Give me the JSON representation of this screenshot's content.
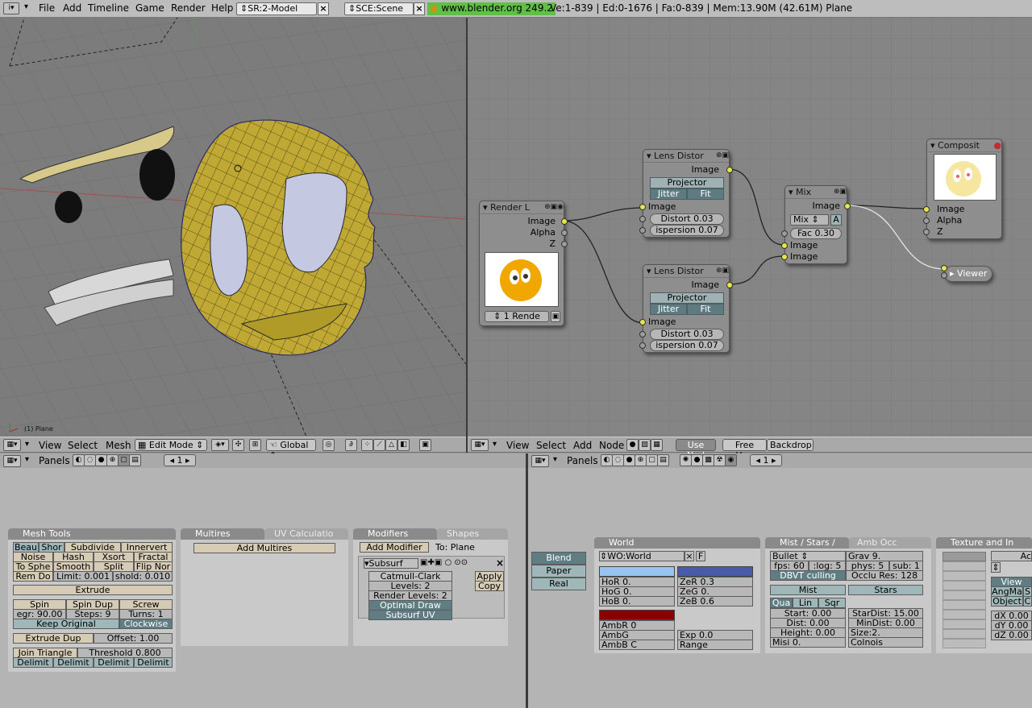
{
  "topbar": {
    "menus": [
      "File",
      "Add",
      "Timeline",
      "Game",
      "Render",
      "Help"
    ],
    "screen": "SR:2-Model",
    "scene": "SCE:Scene",
    "url": "www.blender.org 249.2",
    "stats": "Ve:1-839 | Ed:0-1676 | Fa:0-839 | Mem:13.90M (42.61M) Plane"
  },
  "viewport": {
    "object_label": "(1) Plane"
  },
  "view3d_header": {
    "menus": [
      "View",
      "Select",
      "Mesh"
    ],
    "mode": "Edit Mode",
    "orientation": "Global"
  },
  "node_header": {
    "menus": [
      "View",
      "Select",
      "Add",
      "Node"
    ],
    "use_nodes": "Use Nod",
    "free_unused": "Free Unu",
    "backdrop": "Backdrop"
  },
  "nodes": {
    "render_layers": {
      "title": "Render L",
      "out_image": "Image",
      "out_alpha": "Alpha",
      "out_z": "Z",
      "layer": "1 Rende"
    },
    "lens1": {
      "title": "Lens Distor",
      "out_image": "Image",
      "projector": "Projector",
      "jitter": "Jitter",
      "fit": "Fit",
      "in_image": "Image",
      "distort": "Distort 0.03",
      "dispersion": "ispersion 0.07"
    },
    "lens2": {
      "title": "Lens Distor",
      "out_image": "Image",
      "projector": "Projector",
      "jitter": "Jitter",
      "fit": "Fit",
      "in_image": "Image",
      "distort": "Distort 0.03",
      "dispersion": "ispersion 0.07"
    },
    "mix": {
      "title": "Mix",
      "out_image": "Image",
      "blend": "Mix",
      "alpha": "A",
      "fac": "Fac 0.30",
      "in1": "Image",
      "in2": "Image"
    },
    "composite": {
      "title": "Composit",
      "in_image": "Image",
      "in_alpha": "Alpha",
      "in_z": "Z"
    },
    "viewer": {
      "title": "Viewer"
    }
  },
  "left_panels_header": {
    "label": "Panels",
    "page": "1"
  },
  "right_panels_header": {
    "label": "Panels",
    "page": "1"
  },
  "mesh_tools": {
    "title": "Mesh Tools",
    "row1": [
      "Beau",
      "Shor",
      "Subdivide",
      "Innervert"
    ],
    "row2": [
      "Noise",
      "Hash",
      "Xsort",
      "Fractal"
    ],
    "row3": [
      "To Sphe",
      "Smooth",
      "Split",
      "Flip Nor"
    ],
    "row4": [
      "Rem Do",
      "Limit: 0.001",
      "shold: 0.010"
    ],
    "extrude": "Extrude",
    "row6": [
      "Spin",
      "Spin Dup",
      "Screw"
    ],
    "row7": [
      "egr: 90.00",
      "Steps: 9",
      "Turns: 1"
    ],
    "keep_original": "Keep Original",
    "clockwise": "Clockwise",
    "extrude_dup": "Extrude Dup",
    "offset": "Offset: 1.00",
    "join_triangle": "Join Triangle",
    "threshold": "Threshold 0.800",
    "delimit": [
      "Delimit",
      "Delimit",
      "Delimit",
      "Delimit"
    ]
  },
  "multires": {
    "title": "Multires",
    "tab2": "UV Calculatio",
    "add": "Add Multires"
  },
  "modifiers": {
    "title": "Modifiers",
    "tab2": "Shapes",
    "add": "Add Modifier",
    "to": "To: Plane",
    "subsurf": "Subsurf",
    "type": "Catmull-Clark",
    "levels": "Levels: 2",
    "render_levels": "Render Levels: 2",
    "optimal_draw": "Optimal Draw",
    "subsurf_uv": "Subsurf UV",
    "apply": "Apply",
    "copy": "Copy"
  },
  "preview": {
    "blend": "Blend",
    "paper": "Paper",
    "real": "Real"
  },
  "world": {
    "title": "World",
    "name": "WO:World",
    "f": "F",
    "hor": "HoR 0.",
    "hog": "HoG 0.",
    "hob": "HoB 0.",
    "zer": "ZeR 0.3",
    "zeg": "ZeG 0.",
    "zeb": "ZeB 0.6",
    "ambr": "AmbR 0",
    "ambg": "AmbG",
    "ambb": "AmbB C",
    "exp": "Exp 0.0",
    "range": "Range",
    "horizon_color": "#97c5f0",
    "zenith_color": "#4a5aaa",
    "ambient_color": "#8b0000"
  },
  "mist": {
    "title": "Mist / Stars /",
    "tab2": "Amb Occ",
    "physics": "Bullet",
    "grav": "Grav 9.",
    "fps": "fps: 60",
    "log": ":log: 5",
    "phys": "phys: 5",
    "sub": "sub: 1",
    "dbvt": "DBVT culling",
    "occlu": "Occlu Res: 128",
    "mist": "Mist",
    "stars": "Stars",
    "qua": "Qua",
    "lin": "Lin",
    "sqr": "Sqr",
    "start": "Start: 0.00",
    "dist": "Dist: 0.00",
    "height": "Height: 0.00",
    "misi": "Misi 0.",
    "stardist": "StarDist: 15.00",
    "mindist": "MinDist: 0.00",
    "size": "Size:2.",
    "colnois": "Colnois"
  },
  "texture": {
    "title": "Texture and In",
    "ac": "Ac",
    "view": "View",
    "angma": "AngMa",
    "s": "S",
    "object": "Object",
    "c": "C",
    "dx": "dX 0.00",
    "dy": "dY 0.00",
    "dz": "dZ 0.00"
  }
}
